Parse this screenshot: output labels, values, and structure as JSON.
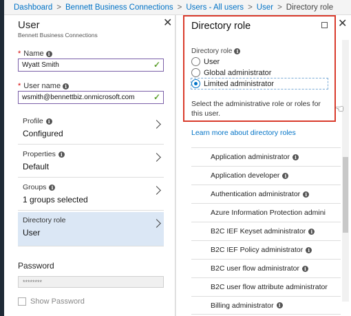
{
  "breadcrumb": {
    "items": [
      "Dashboard",
      "Bennett Business Connections",
      "Users - All users",
      "User",
      "Directory role"
    ]
  },
  "user_blade": {
    "title": "User",
    "subtitle": "Bennett Business Connections",
    "name_label": "Name",
    "name_value": "Wyatt Smith",
    "username_label": "User name",
    "username_value": "wsmith@bennettbiz.onmicrosoft.com",
    "nav": [
      {
        "label": "Profile",
        "value": "Configured",
        "has_info": true
      },
      {
        "label": "Properties",
        "value": "Default",
        "has_info": true
      },
      {
        "label": "Groups",
        "value": "1 groups selected",
        "has_info": true
      },
      {
        "label": "Directory role",
        "value": "User",
        "has_info": false
      }
    ],
    "password_label": "Password",
    "password_value": "********",
    "show_password_label": "Show Password"
  },
  "role_blade": {
    "title": "Directory role",
    "role_label": "Directory role",
    "options": [
      "User",
      "Global administrator",
      "Limited administrator"
    ],
    "selected_option": "Limited administrator",
    "description": "Select the administrative role or roles for this user.",
    "learn_more": "Learn more about directory roles",
    "roles": [
      {
        "name": "Application administrator",
        "info": true
      },
      {
        "name": "Application developer",
        "info": true
      },
      {
        "name": "Authentication administrator",
        "info": true
      },
      {
        "name": "Azure Information Protection admini",
        "info": false
      },
      {
        "name": "B2C IEF Keyset administrator",
        "info": true
      },
      {
        "name": "B2C IEF Policy administrator",
        "info": true
      },
      {
        "name": "B2C user flow administrator",
        "info": true
      },
      {
        "name": "B2C user flow attribute administrator",
        "info": false
      },
      {
        "name": "Billing administrator",
        "info": true
      }
    ]
  },
  "colors": {
    "accent": "#0072c6",
    "highlight_border": "#d93a2b",
    "valid_check": "#5ea02f",
    "active_nav": "#dbe7f5"
  }
}
